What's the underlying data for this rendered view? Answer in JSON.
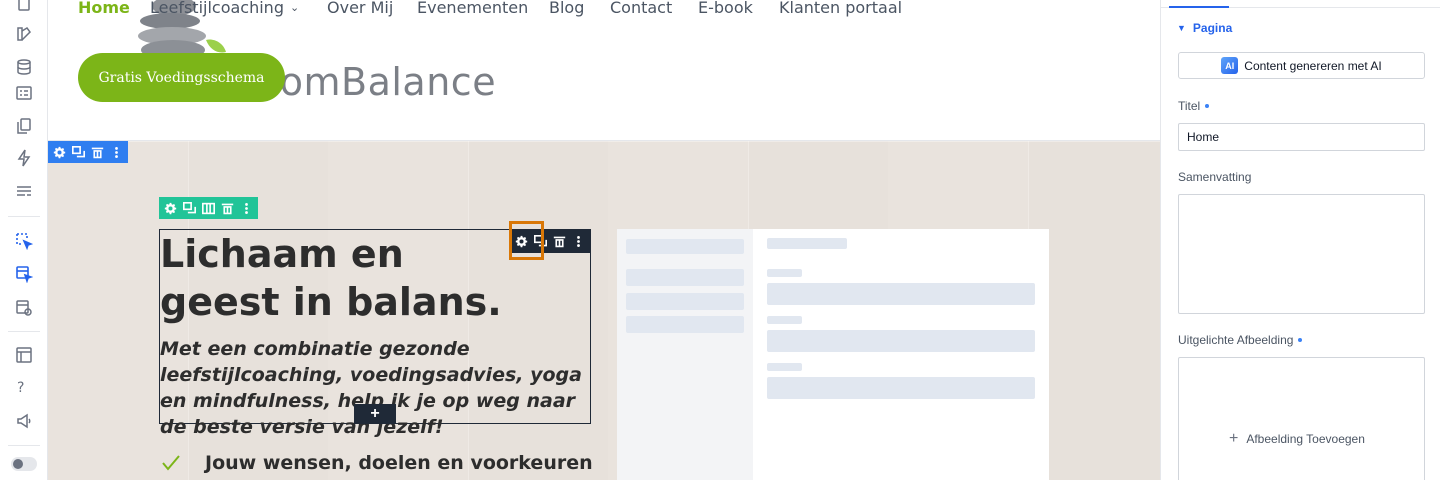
{
  "site": {
    "nav": [
      {
        "label": "Home",
        "active": true
      },
      {
        "label": "Leefstijlcoaching",
        "has_dropdown": true
      },
      {
        "label": "Over Mij"
      },
      {
        "label": "Evenementen"
      },
      {
        "label": "Blog"
      },
      {
        "label": "Contact"
      },
      {
        "label": "E-book"
      },
      {
        "label": "Klanten portaal"
      }
    ],
    "logo_text": "oomBalance",
    "cta_label": "Gratis Voedingsschema"
  },
  "hero": {
    "title": "Lichaam en geest in balans.",
    "subtitle": "Met een combinatie gezonde leefstijlcoaching, voedingsadvies, yoga en mindfulness, help ik je op weg naar de beste versie van jezelf!",
    "checklist": [
      "Jouw wensen, doelen en voorkeuren"
    ],
    "add_handle": "+"
  },
  "panel": {
    "section_title": "Pagina",
    "ai_badge": "AI",
    "ai_button_label": "Content genereren met AI",
    "title_label": "Titel",
    "title_value": "Home",
    "summary_label": "Samenvatting",
    "summary_value": "",
    "image_label": "Uitgelichte Afbeelding",
    "add_image_label": "Afbeelding Toevoegen"
  },
  "toolbar": {
    "help_glyph": "?"
  },
  "colors": {
    "brand_green": "#7cb518",
    "section_control_blue": "#2f7ef0",
    "row_control_green": "#21c498",
    "element_control_dark": "#1f2937",
    "highlight_orange": "#d97706",
    "accent_blue": "#2563eb"
  },
  "icons": {
    "left_toolbar": [
      "pages-icon",
      "theme-icon",
      "database-icon",
      "forms-icon",
      "copy-icon",
      "lightning-icon",
      "layout-icon",
      "select-element-icon",
      "select-section-icon",
      "preview-icon",
      "layers-icon",
      "help-icon",
      "announce-icon",
      "theme-toggle"
    ],
    "section_controls": [
      "gear-icon",
      "duplicate-icon",
      "delete-icon",
      "more-icon"
    ],
    "row_controls": [
      "gear-icon",
      "duplicate-icon",
      "columns-icon",
      "delete-icon",
      "more-icon"
    ],
    "element_controls": [
      "gear-icon",
      "duplicate-icon",
      "delete-icon",
      "more-icon"
    ]
  }
}
